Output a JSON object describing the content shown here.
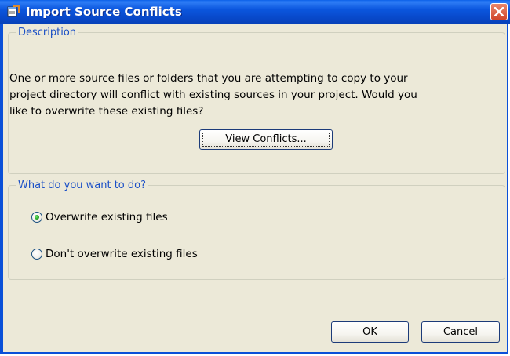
{
  "window": {
    "title": "Import Source Conflicts",
    "icon": "app-document-icon",
    "close_icon": "close-icon"
  },
  "description": {
    "legend": "Description",
    "lines": [
      "One or more source files or folders that you are attempting to copy to your",
      "project directory will conflict with existing sources in your project. Would you",
      "like to overwrite these existing files?"
    ],
    "view_conflicts_label": "View Conflicts..."
  },
  "options": {
    "legend": "What do you want to do?",
    "overwrite_label": "Overwrite existing files",
    "dont_overwrite_label": "Don't overwrite existing files",
    "selected": "overwrite"
  },
  "buttons": {
    "ok_label": "OK",
    "cancel_label": "Cancel"
  },
  "colors": {
    "title_bar": "#0b56de",
    "dialog_bg": "#ece9d8",
    "legend_text": "#1a4fc6",
    "close_button": "#d1462a",
    "radio_selected": "#21a121"
  }
}
